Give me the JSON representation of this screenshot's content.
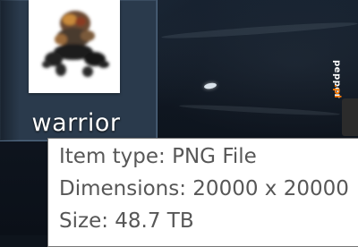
{
  "desktop": {
    "file": {
      "name": "warrior",
      "icon": "png-thumbnail-warrior"
    },
    "tooltip": {
      "type_line": "Item type: PNG File",
      "dimensions_line": "Dimensions: 20000 x 20000",
      "size_line": "Size: 48.7 TB"
    },
    "watermark": {
      "name": "pepper",
      "dot": ".pl"
    }
  },
  "colors": {
    "selection": "#2a3a4c",
    "tooltip_bg": "#ffffff",
    "tooltip_text": "#575757",
    "label_text": "#ffffff"
  }
}
